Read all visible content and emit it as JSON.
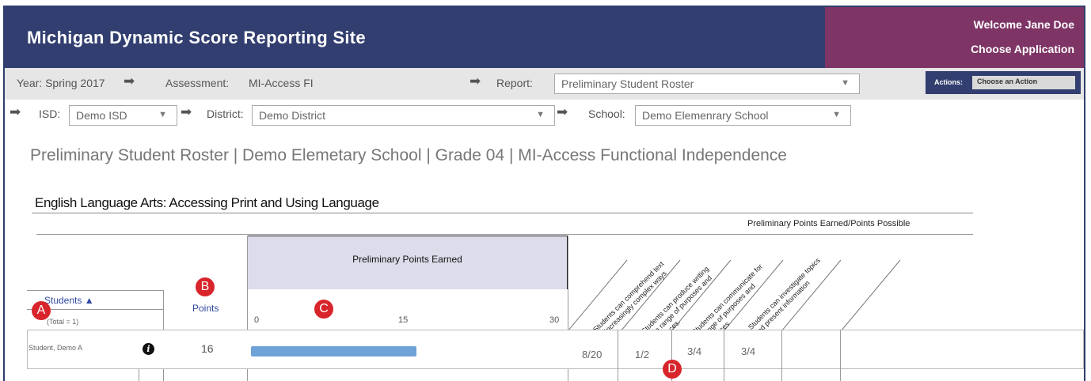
{
  "header": {
    "title": "Michigan Dynamic Score Reporting Site",
    "welcome": "Welcome Jane Doe",
    "choose_app": "Choose Application"
  },
  "filters": {
    "year": "Year: Spring 2017",
    "assessment_label": "Assessment:",
    "assessment_value": "MI-Access FI",
    "report_label": "Report:",
    "report_value": "Preliminary Student Roster",
    "actions_label": "Actions:",
    "actions_value": "Choose an Action",
    "isd_label": "ISD:",
    "isd_value": "Demo ISD",
    "district_label": "District:",
    "district_value": "Demo District",
    "school_label": "School:",
    "school_value": "Demo Elemenrary School"
  },
  "page_title": "Preliminary Student Roster  |  Demo Elemetary School  |  Grade 04  |  MI-Access Functional Independence",
  "section_title": "English Language Arts: Accessing Print and Using Language",
  "table": {
    "ppe_possible": "Preliminary Points Earned/Points Possible",
    "ppe_header": "Preliminary Points Earned",
    "students_header": "Students ▲",
    "total": "(Total = 1)",
    "points_header": "Points",
    "axis_ticks": [
      "0",
      "15",
      "30"
    ],
    "axis_max": 30,
    "claims": [
      "Students can comprehend text\nin increasingly complex ways",
      "Students can produce writing\nfor a range of purposes and\nevidences.",
      "Students can communicate for\na range of purposes and\nevidences",
      "Students can investigate topics\nand present information"
    ],
    "rows": [
      {
        "name": "Student, Demo A",
        "points": "16",
        "points_value": 16,
        "scores": [
          "8/20",
          "1/2",
          "3/4",
          "3/4"
        ]
      }
    ]
  },
  "markers": [
    "A",
    "B",
    "C",
    "D"
  ],
  "colors": {
    "header": "#323e6f",
    "user_panel": "#7e3566",
    "bar": "#6fa2d6",
    "marker": "#d8242b"
  }
}
